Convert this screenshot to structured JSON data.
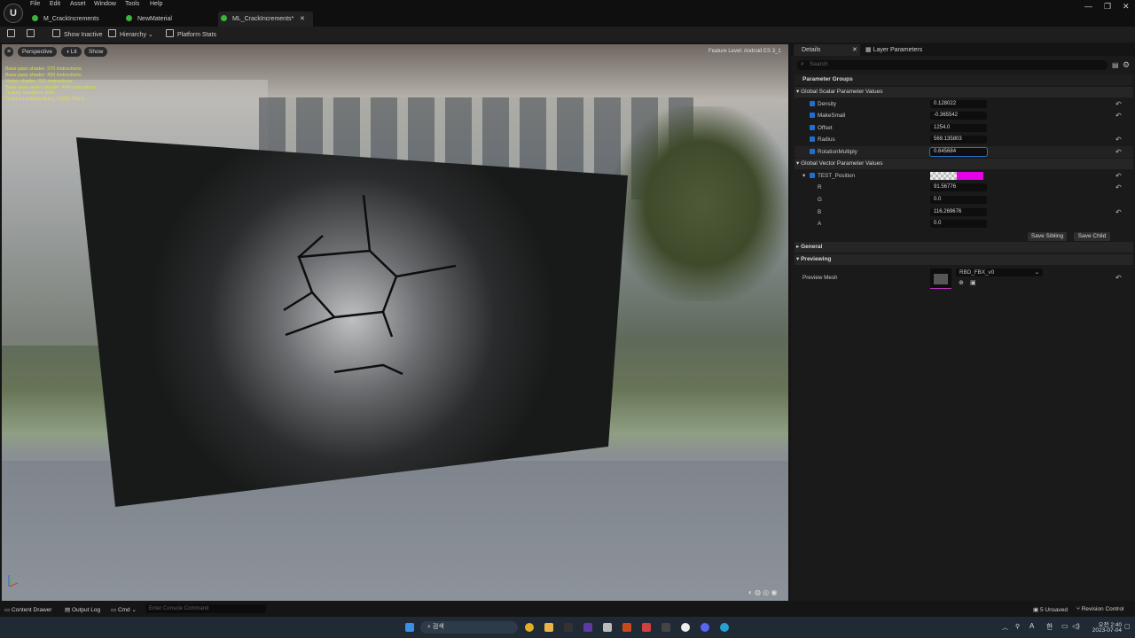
{
  "menu": [
    "File",
    "Edit",
    "Asset",
    "Window",
    "Tools",
    "Help"
  ],
  "tabs": [
    "M_CrackIncrements",
    "NewMaterial",
    "ML_CrackIncrements*"
  ],
  "toolbar": {
    "show_inactive": "Show Inactive",
    "hierarchy": "Hierarchy",
    "platform_stats": "Platform Stats"
  },
  "viewport": {
    "perspective": "Perspective",
    "lit": "Lit",
    "show": "Show",
    "stats": [
      "Base pass shader: 270 instructions",
      "Base pass shader: 430 instructions",
      "Vertex shader: 315 instructions",
      "Base pass vertex shader: 494 instructions",
      "Texture samplers: 6/16",
      "Texture Lookups (Est.): VS(0), PS(2)"
    ],
    "feature_level": "Feature Level: Android ES 3_1"
  },
  "details": {
    "tab_details": "Details",
    "tab_layer": "Layer Parameters",
    "search_placeholder": "Search",
    "parameter_groups": "Parameter Groups",
    "scalar_header": "Global Scalar Parameter Values",
    "scalars": [
      {
        "name": "Density",
        "value": "0.128022"
      },
      {
        "name": "MakeSmall",
        "value": "-0.365542"
      },
      {
        "name": "Offset",
        "value": "1254.0"
      },
      {
        "name": "Radius",
        "value": "569.135803"
      },
      {
        "name": "RotationMultiply",
        "value": "0.645684"
      }
    ],
    "vector_header": "Global Vector Parameter Values",
    "vector_name": "TEST_Position",
    "vector_color": "#e600e6",
    "channels": [
      {
        "name": "R",
        "value": "91.56776"
      },
      {
        "name": "G",
        "value": "0.0"
      },
      {
        "name": "B",
        "value": "116.269676"
      },
      {
        "name": "A",
        "value": "0.0"
      }
    ],
    "save_sibling": "Save Sibling",
    "save_child": "Save Child",
    "general": "General",
    "previewing": "Previewing",
    "preview_mesh_label": "Preview Mesh",
    "preview_mesh_value": "RBD_FBX_v0"
  },
  "status": {
    "content_drawer": "Content Drawer",
    "output_log": "Output Log",
    "cmd": "Cmd",
    "console_placeholder": "Enter Console Command",
    "unsaved": "5 Unsaved",
    "revision": "Revision Control"
  },
  "taskbar": {
    "search": "검색",
    "time": "오전 2:40",
    "date": "2023-07-04",
    "lang": "A",
    "ime": "한"
  }
}
